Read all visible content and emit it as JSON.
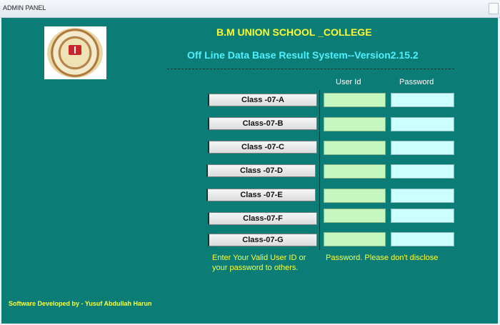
{
  "window": {
    "title": "ADMIN PANEL"
  },
  "header": {
    "school_name": "B.M UNION SCHOOL _COLLEGE",
    "system_name": "Off Line Data Base Result System--Version2.15.2"
  },
  "columns": {
    "user_id": "User Id",
    "password": "Password"
  },
  "classes": [
    {
      "label": "Class -07-A"
    },
    {
      "label": "Class-07-B"
    },
    {
      "label": "Class -07-C"
    },
    {
      "label": "Class -07-D"
    },
    {
      "label": "Class -07-E"
    },
    {
      "label": "Class-07-F"
    },
    {
      "label": "Class-07-G"
    }
  ],
  "notice": {
    "line1_left": "Enter Your Valid User ID or",
    "line1_right": "Password. Please don't  disclose",
    "line2": "your password to others."
  },
  "footer": {
    "credit": "Software Developed by - Yusuf Abdullah Harun"
  },
  "colors": {
    "panel": "#0c7c76",
    "heading": "#ffff33",
    "subheading": "#4df2ff",
    "userid_field": "#c4f6be",
    "password_field": "#ccffff"
  }
}
